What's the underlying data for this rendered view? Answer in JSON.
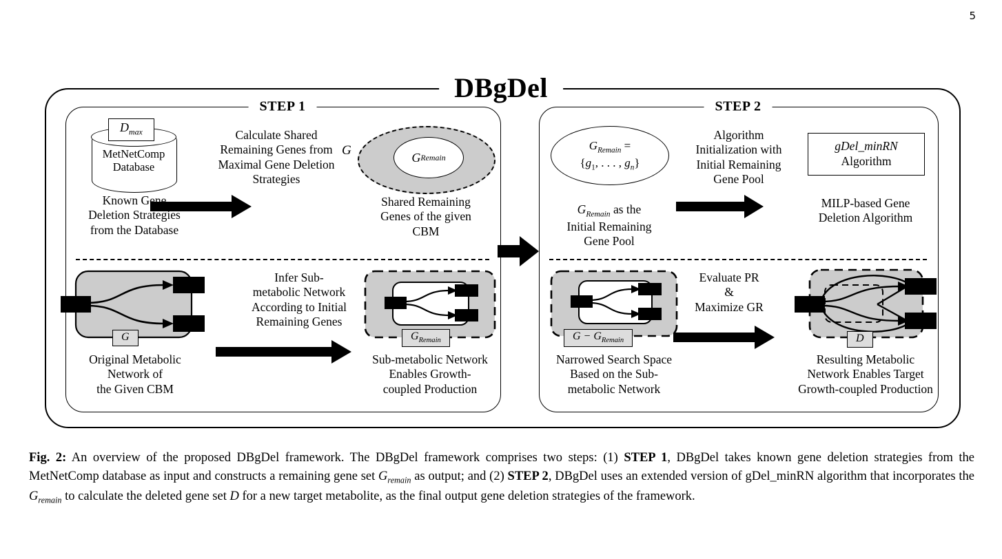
{
  "page_number": "5",
  "figure": {
    "title": "DBgDel",
    "steps": [
      {
        "label": "STEP 1"
      },
      {
        "label": "STEP 2"
      }
    ],
    "top_row": {
      "step1": {
        "database": {
          "dmax_label": "Dmax",
          "name": "MetNetComp\nDatabase",
          "caption": "Known Gene\nDeletion Strategies\nfrom the Database"
        },
        "arrow_label": "Calculate Shared\nRemaining Genes from\nMaximal Gene Deletion\nStrategies",
        "result": {
          "outer_label": "G",
          "inner_label": "GRemain",
          "caption": "Shared Remaining\nGenes of the given\nCBM"
        }
      },
      "step2": {
        "pool": {
          "ellipse_line1": "GRemain =",
          "ellipse_line2": "{g1, . . . , gn}",
          "caption": "GRemain as the\nInitial Remaining\nGene Pool"
        },
        "arrow_label": "Algorithm\nInitialization with\nInitial Remaining\nGene Pool",
        "algorithm": {
          "box_line1": "gDel_minRN",
          "box_line2": "Algorithm",
          "caption": "MILP-based Gene\nDeletion Algorithm"
        }
      }
    },
    "bottom_row": {
      "step1": {
        "original_network": {
          "tag": "G",
          "caption": "Original Metabolic\nNetwork of\nthe Given CBM"
        },
        "arrow_label": "Infer Sub-\nmetabolic Network\nAccording to Initial\nRemaining Genes",
        "sub_network": {
          "tag": "GRemain",
          "caption": "Sub-metabolic Network\nEnables Growth-\ncoupled Production"
        }
      },
      "step2": {
        "narrowed_network": {
          "tag": "G − GRemain",
          "caption": "Narrowed Search Space\nBased on the Sub-\nmetabolic Network"
        },
        "arrow_label": "Evaluate PR\n&\nMaximize GR",
        "resulting_network": {
          "tag": "D",
          "caption": "Resulting Metabolic\nNetwork Enables Target\nGrowth-coupled Production"
        }
      }
    }
  },
  "caption": {
    "label": "Fig. 2:",
    "text_1": " An overview of the proposed DBgDel framework. The DBgDel framework comprises two steps: (1) ",
    "step1_bold": "STEP 1",
    "text_2": ", DBgDel takes known gene deletion strategies from the MetNetComp database as input and constructs a remaining gene set ",
    "gremain_1": "Gremain",
    "text_3": " as output; and (2) ",
    "step2_bold": "STEP 2",
    "text_4": ", DBgDel uses an extended version of gDel_minRN algorithm that incorporates the ",
    "gremain_2": "Gremain",
    "text_5": " to calculate the deleted gene set ",
    "d_italic": "D",
    "text_6": " for a new target metabolite, as the final output gene deletion strategies of the framework."
  },
  "colors": {
    "gray_fill": "#cccccc",
    "tag_fill": "#dddddd",
    "stroke": "#000000",
    "background": "#ffffff"
  }
}
